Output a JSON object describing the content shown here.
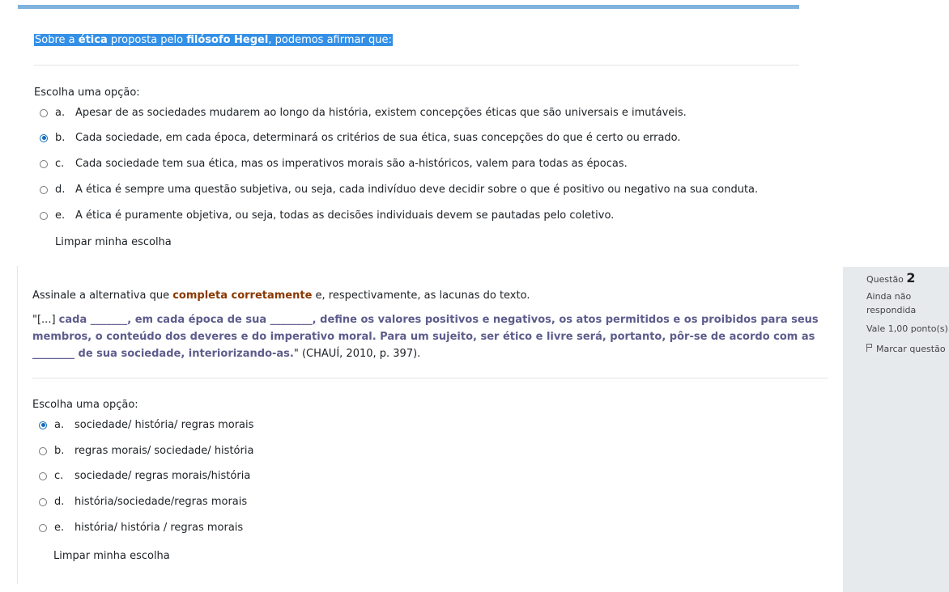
{
  "question1": {
    "text_pre": "Sobre a ",
    "text_b1": "ética",
    "text_mid": " proposta pelo ",
    "text_b2": "filósofo Hegel",
    "text_post": ", podemos afirmar que:",
    "prompt": "Escolha uma opção:",
    "options": [
      {
        "letter": "a.",
        "text": "Apesar de as sociedades mudarem ao longo da história, existem concepções éticas que são universais e imutáveis.",
        "checked": false
      },
      {
        "letter": "b.",
        "text": "Cada sociedade, em cada época, determinará os critérios de sua ética, suas concepções do que é certo ou errado.",
        "checked": true
      },
      {
        "letter": "c.",
        "text": "Cada sociedade tem sua ética, mas os imperativos morais são a-históricos, valem para todas as épocas.",
        "checked": false
      },
      {
        "letter": "d.",
        "text": "A ética é sempre uma questão subjetiva, ou seja, cada indivíduo deve decidir sobre o que é positivo ou negativo na sua conduta.",
        "checked": false
      },
      {
        "letter": "e.",
        "text": "A ética é puramente objetiva, ou seja, todas as decisões individuais devem se pautadas pelo coletivo.",
        "checked": false
      }
    ],
    "clear_label": "Limpar minha escolha"
  },
  "question2": {
    "info": {
      "label": "Questão",
      "number": "2",
      "status": "Ainda não respondida",
      "points": "Vale 1,00 ponto(s).",
      "flag_label": "Marcar questão"
    },
    "intro_pre": "Assinale a alternativa que ",
    "intro_hl": "completa corretamente",
    "intro_post": " e, respectivamente, as lacunas do texto.",
    "quote_open": "\"[...] ",
    "quote_bold": "cada _______, em cada época de sua ________, define os valores positivos e negativos, os atos permitidos e os proibidos para seus membros, o conteúdo dos deveres e do imperativo moral. Para um sujeito, ser ético e livre será, portanto, pôr-se de acordo com as ________ de sua sociedade, interiorizando-as.",
    "quote_close": "\" (CHAUÍ, 2010, p. 397).",
    "prompt": "Escolha uma opção:",
    "options": [
      {
        "letter": "a.",
        "text": "sociedade/ história/ regras morais",
        "checked": true
      },
      {
        "letter": "b.",
        "text": "regras morais/ sociedade/ história",
        "checked": false
      },
      {
        "letter": "c.",
        "text": "sociedade/ regras morais/história",
        "checked": false
      },
      {
        "letter": "d.",
        "text": "história/sociedade/regras morais",
        "checked": false
      },
      {
        "letter": "e.",
        "text": "história/ história / regras morais",
        "checked": false
      }
    ],
    "clear_label": "Limpar minha escolha"
  },
  "colors": {
    "accent": "#0f6cbf",
    "selection": "#3390e6",
    "highlight": "#8a3800",
    "quote": "#5e5c8c"
  }
}
